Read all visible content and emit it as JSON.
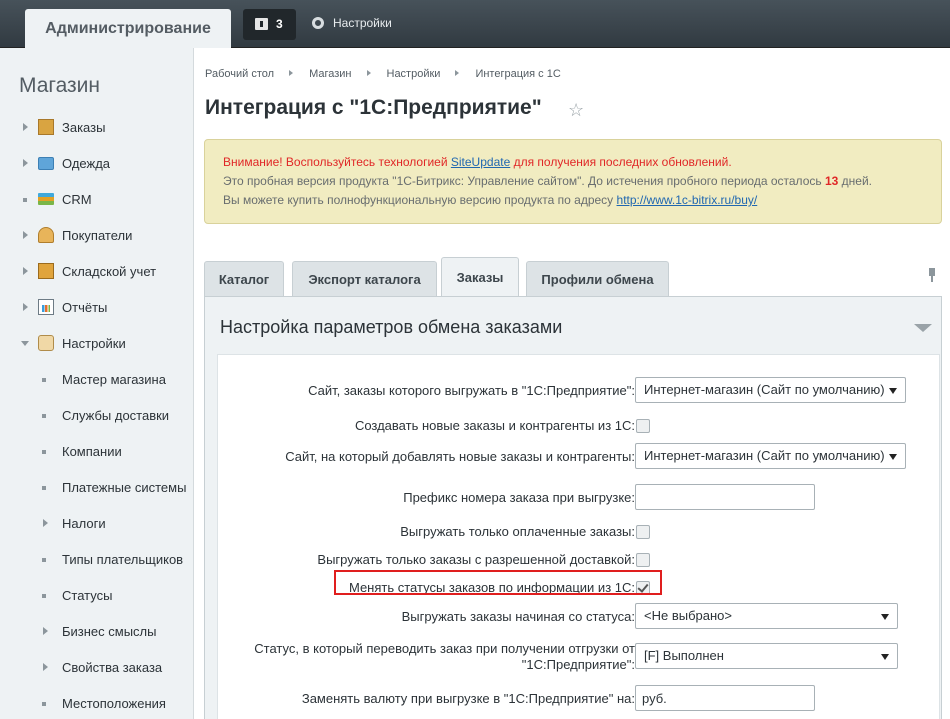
{
  "topbar": {
    "admin_tab": "Администрирование",
    "notifications_count": "3",
    "settings_label": "Настройки"
  },
  "sidebar": {
    "title": "Магазин",
    "items": [
      {
        "label": "Заказы",
        "icon": "orders-icon"
      },
      {
        "label": "Одежда",
        "icon": "folder-icon"
      },
      {
        "label": "CRM",
        "icon": "crm-icon"
      },
      {
        "label": "Покупатели",
        "icon": "users-icon"
      },
      {
        "label": "Складской учет",
        "icon": "warehouse-icon"
      },
      {
        "label": "Отчёты",
        "icon": "reports-icon"
      },
      {
        "label": "Настройки",
        "icon": "settings-icon"
      }
    ],
    "subitems": [
      "Мастер магазина",
      "Службы доставки",
      "Компании",
      "Платежные системы",
      "Налоги",
      "Типы плательщиков",
      "Статусы",
      "Бизнес смыслы",
      "Свойства заказа",
      "Местоположения"
    ]
  },
  "breadcrumb": [
    "Рабочий стол",
    "Магазин",
    "Настройки",
    "Интеграция с 1С"
  ],
  "page_title": "Интеграция с \"1С:Предприятие\"",
  "alert": {
    "line1_pre": "Внимание! Воспользуйтесь технологией ",
    "line1_link": "SiteUpdate",
    "line1_post": " для получения последних обновлений.",
    "line2_pre": "Это пробная версия продукта \"1С-Битрикс: Управление сайтом\". До истечения пробного периода осталось ",
    "line2_days": "13",
    "line2_post": " дней.",
    "line3_pre": "Вы можете купить полнофункциональную  версию продукта по адресу ",
    "line3_link": "http://www.1c-bitrix.ru/buy/"
  },
  "tabs": [
    "Каталог",
    "Экспорт каталога",
    "Заказы",
    "Профили обмена"
  ],
  "active_tab": "Заказы",
  "section_title": "Настройка параметров обмена заказами",
  "form": {
    "site_export_label": "Сайт, заказы которого выгружать в \"1С:Предприятие\":",
    "site_export_value": "Интернет-магазин (Сайт по умолчанию)",
    "create_new_label": "Создавать новые заказы и контрагенты из 1С:",
    "create_new_checked": false,
    "site_add_label": "Сайт, на который добавлять новые заказы и контрагенты:",
    "site_add_value": "Интернет-магазин (Сайт по умолчанию)",
    "prefix_label": "Префикс номера заказа при выгрузке:",
    "prefix_value": "",
    "only_paid_label": "Выгружать только оплаченные заказы:",
    "only_paid_checked": false,
    "only_delivery_label": "Выгружать только заказы с разрешенной доставкой:",
    "only_delivery_checked": false,
    "change_status_label": "Менять статусы заказов по информации из 1С:",
    "change_status_checked": true,
    "from_status_label": "Выгружать заказы начиная со статуса:",
    "from_status_value": "<Не выбрано>",
    "shipment_status_label_1": "Статус, в который переводить заказ при получении отгрузки от",
    "shipment_status_label_2": "\"1С:Предприятие\":",
    "shipment_status_value": "[F] Выполнен",
    "currency_label": "Заменять валюту при выгрузке в \"1С:Предприятие\" на:",
    "currency_value": "руб."
  }
}
